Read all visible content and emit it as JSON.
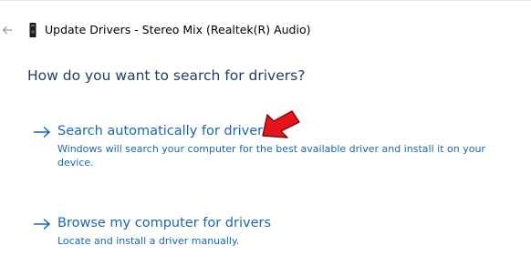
{
  "window": {
    "title": "Update Drivers - Stereo Mix (Realtek(R) Audio)"
  },
  "icons": {
    "back": "back-arrow-icon",
    "device": "audio-device-icon",
    "option_arrow": "right-arrow-icon",
    "annotation": "red-pointer-arrow-icon"
  },
  "main": {
    "heading": "How do you want to search for drivers?",
    "options": [
      {
        "title": "Search automatically for drivers",
        "description": "Windows will search your computer for the best available driver and install it on your device."
      },
      {
        "title": "Browse my computer for drivers",
        "description": "Locate and install a driver manually."
      }
    ]
  },
  "colors": {
    "heading": "#1e3f66",
    "link": "#1a66b3",
    "annotation": "#e8141b"
  }
}
